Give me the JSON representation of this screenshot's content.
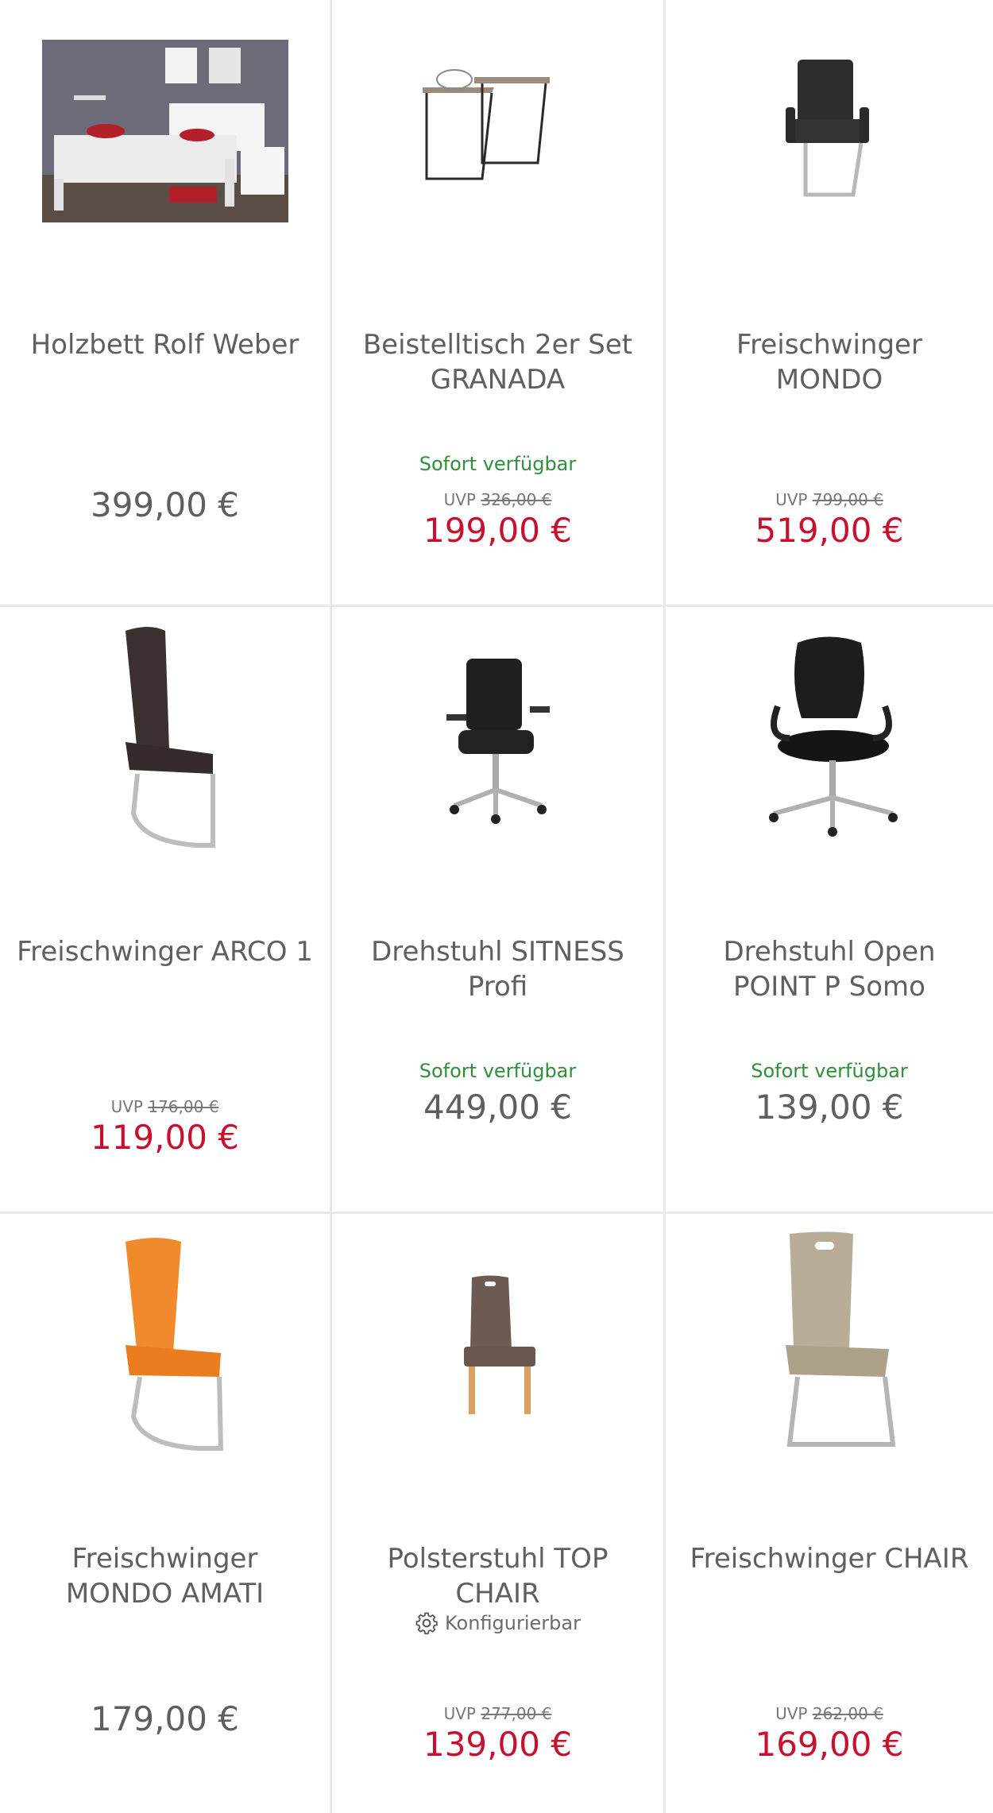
{
  "products": [
    {
      "name": "Holzbett Rolf Weber",
      "availability": "",
      "uvp_label": "",
      "uvp_old_price": "",
      "price": "399,00 €",
      "price_type": "plain",
      "configurable_label": ""
    },
    {
      "name": "Beistelltisch 2er Set GRANADA",
      "availability": "Sofort verfügbar",
      "uvp_label": "UVP",
      "uvp_old_price": "326,00 €",
      "price": "199,00 €",
      "price_type": "sale",
      "configurable_label": ""
    },
    {
      "name": "Freischwinger MONDO",
      "availability": "",
      "uvp_label": "UVP",
      "uvp_old_price": "799,00 €",
      "price": "519,00 €",
      "price_type": "sale",
      "configurable_label": ""
    },
    {
      "name": "Freischwinger ARCO 1",
      "availability": "",
      "uvp_label": "UVP",
      "uvp_old_price": "176,00 €",
      "price": "119,00 €",
      "price_type": "sale",
      "configurable_label": ""
    },
    {
      "name": "Drehstuhl SITNESS Profi",
      "availability": "Sofort verfügbar",
      "uvp_label": "",
      "uvp_old_price": "",
      "price": "449,00 €",
      "price_type": "plain",
      "configurable_label": ""
    },
    {
      "name": "Drehstuhl Open POINT P Somo",
      "availability": "Sofort verfügbar",
      "uvp_label": "",
      "uvp_old_price": "",
      "price": "139,00 €",
      "price_type": "plain",
      "configurable_label": ""
    },
    {
      "name": "Freischwinger MONDO AMATI",
      "availability": "",
      "uvp_label": "",
      "uvp_old_price": "",
      "price": "179,00 €",
      "price_type": "plain",
      "configurable_label": ""
    },
    {
      "name": "Polsterstuhl TOP CHAIR",
      "availability": "",
      "uvp_label": "UVP",
      "uvp_old_price": "277,00 €",
      "price": "139,00 €",
      "price_type": "sale",
      "configurable_label": "Konfigurierbar"
    },
    {
      "name": "Freischwinger CHAIR",
      "availability": "",
      "uvp_label": "UVP",
      "uvp_old_price": "262,00 €",
      "price": "169,00 €",
      "price_type": "sale",
      "configurable_label": ""
    }
  ],
  "colors": {
    "sale_price": "#c8102e",
    "availability": "#2f8f3a",
    "text": "#5f5f5f",
    "divider": "#e9e9e9"
  },
  "icons": [
    "bed-image",
    "side-table-image",
    "chair-image",
    "office-chair-image",
    "gear-icon"
  ]
}
